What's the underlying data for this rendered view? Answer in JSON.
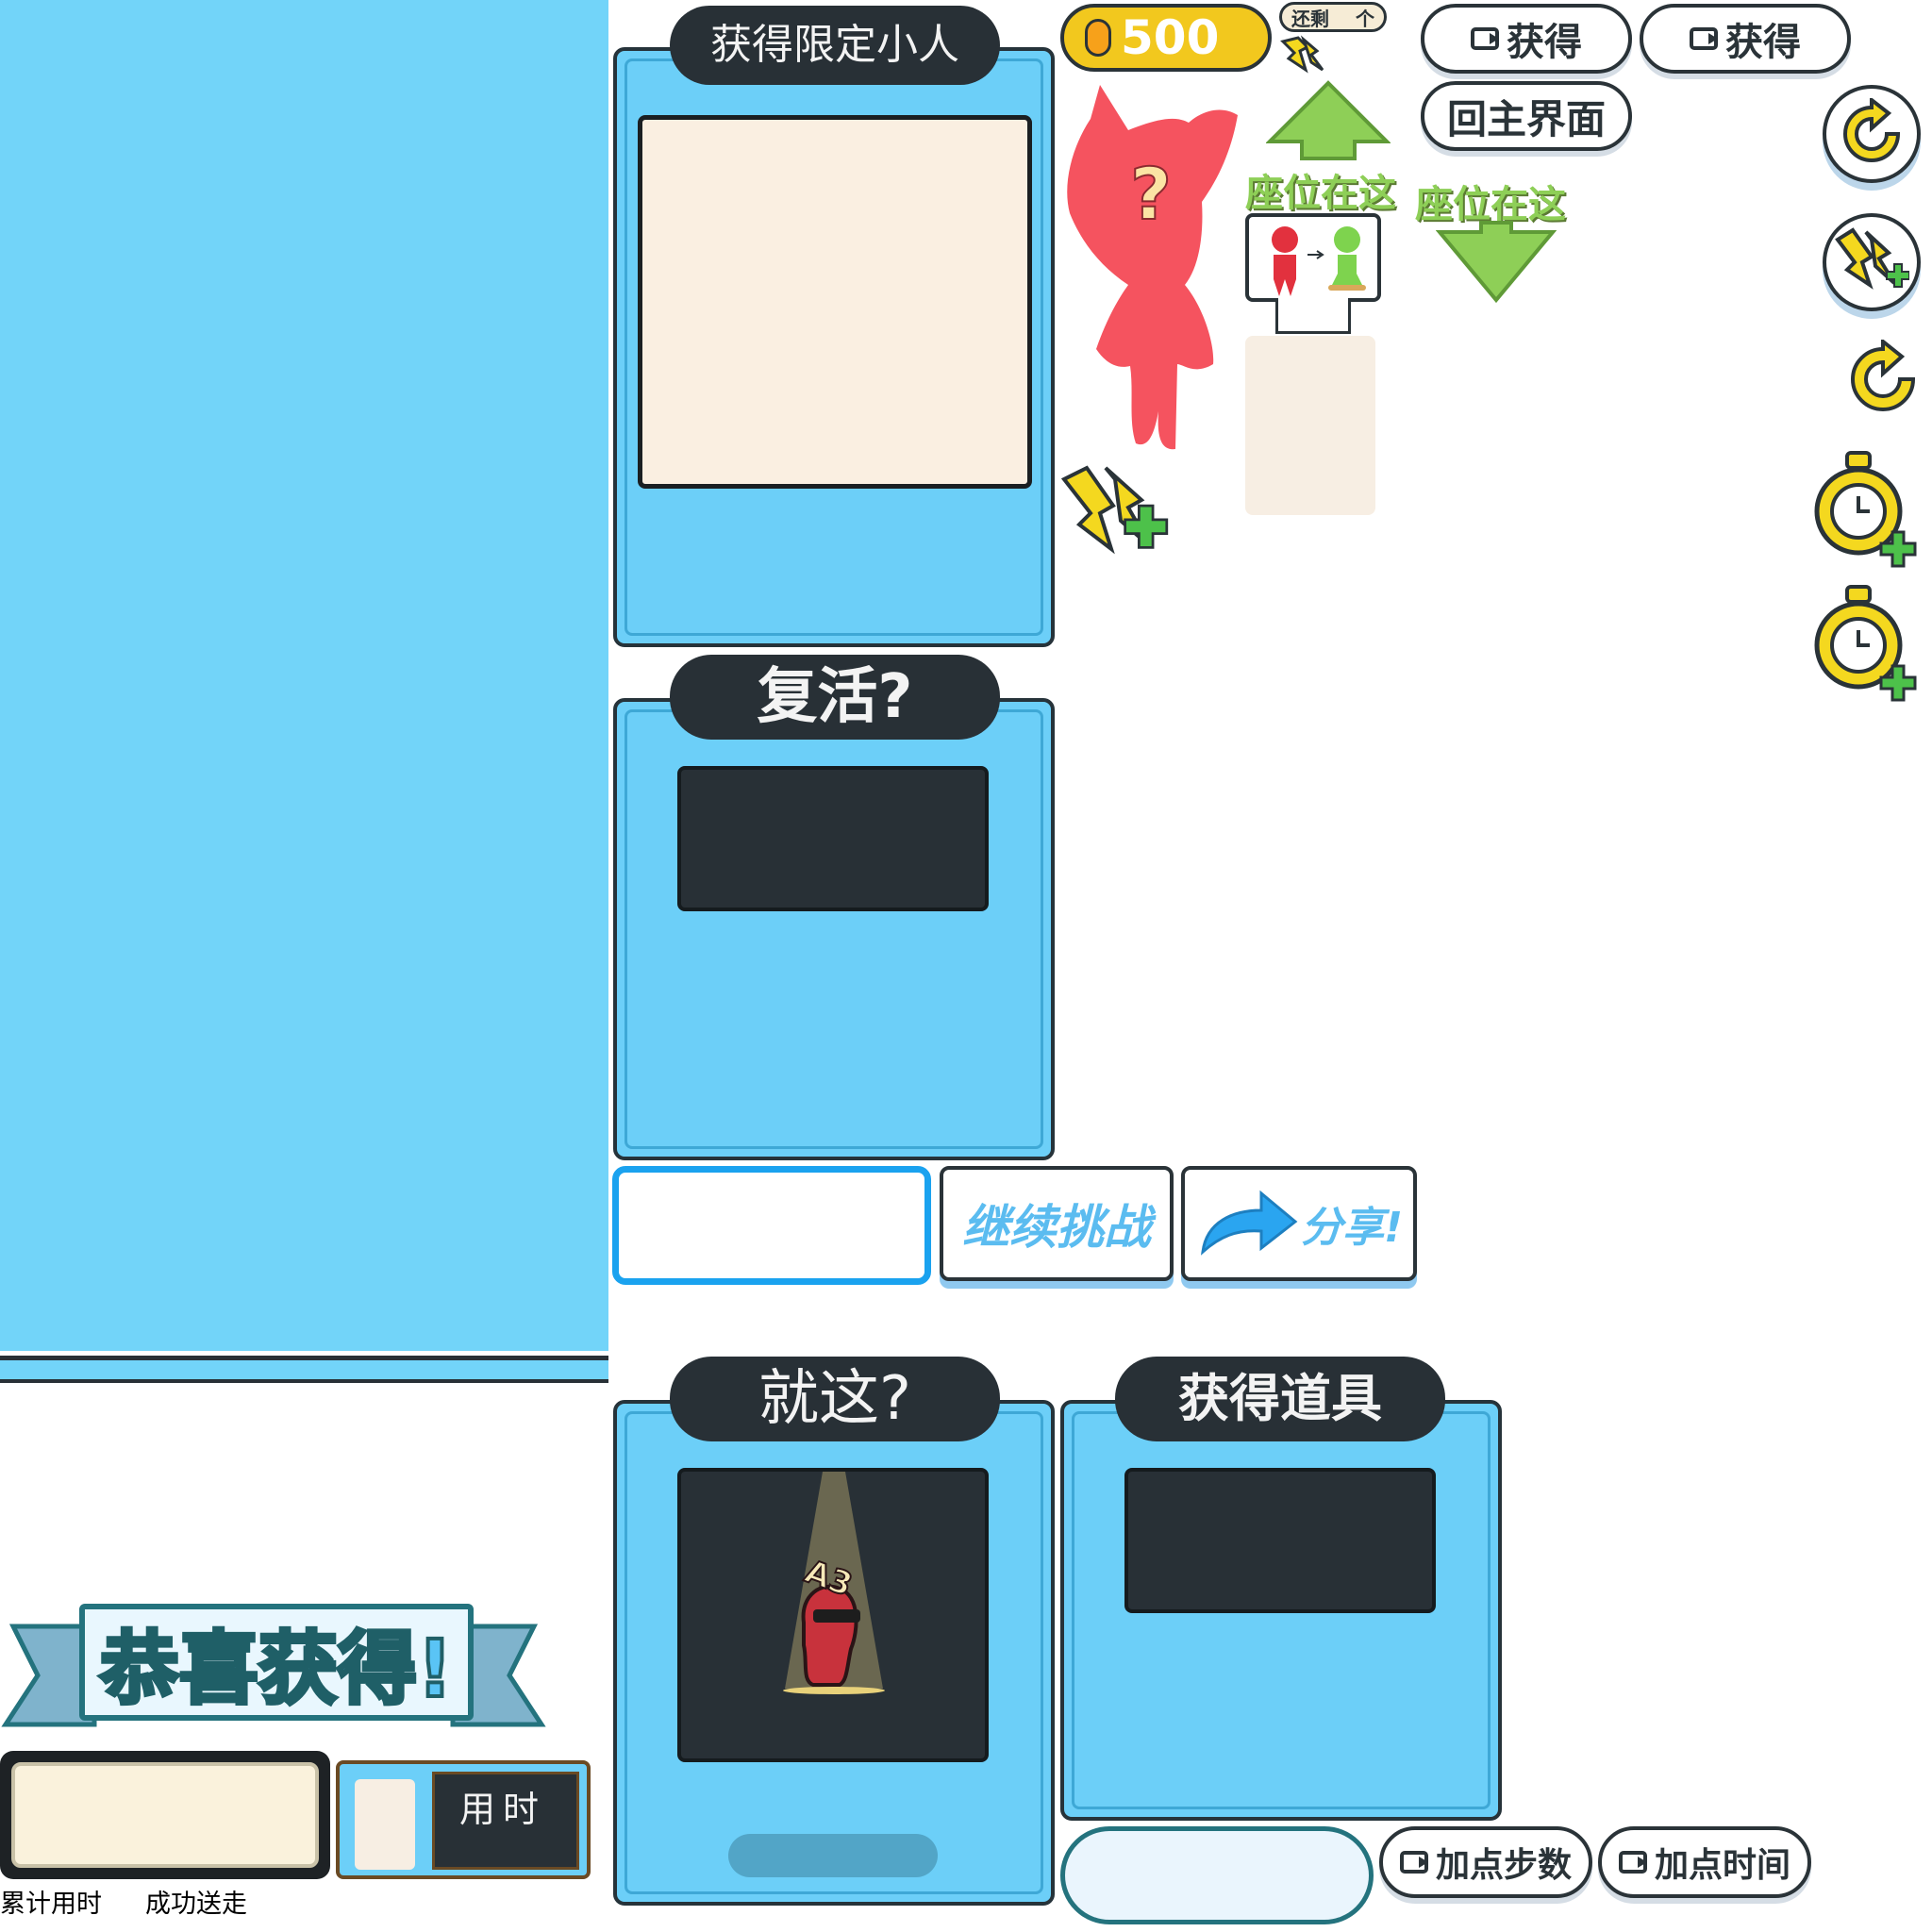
{
  "panels": {
    "get_limited": {
      "title": "获得限定小人"
    },
    "revive": {
      "title": "复活?"
    },
    "just_this": {
      "title": "就这?"
    },
    "get_item": {
      "title": "获得道具"
    }
  },
  "coins": {
    "value": "500"
  },
  "remaining": {
    "label": "还剩",
    "unit": "个"
  },
  "buttons": {
    "video_get_1": "获得",
    "video_get_2": "获得",
    "main_menu": "回主界面",
    "continue_challenge": "继续挑战",
    "share": "分享!",
    "add_steps": "加点步数",
    "add_time": "加点时间"
  },
  "seat": {
    "label_left": "座位在这",
    "label_right": "座位在这"
  },
  "mystery": {
    "mark": "?"
  },
  "congrats": {
    "title": "恭喜获得!"
  },
  "time_board": {
    "label": "用时"
  },
  "footer": {
    "total_time": "累计用时",
    "success_sent": "成功送走"
  },
  "character_badge": {
    "text": "A3"
  },
  "colors": {
    "panel_blue": "#6ccff8",
    "dark": "#283036",
    "cream": "#faefe1",
    "gold": "#f2c81e",
    "green": "#8ecf57",
    "red": "#f5535f"
  }
}
